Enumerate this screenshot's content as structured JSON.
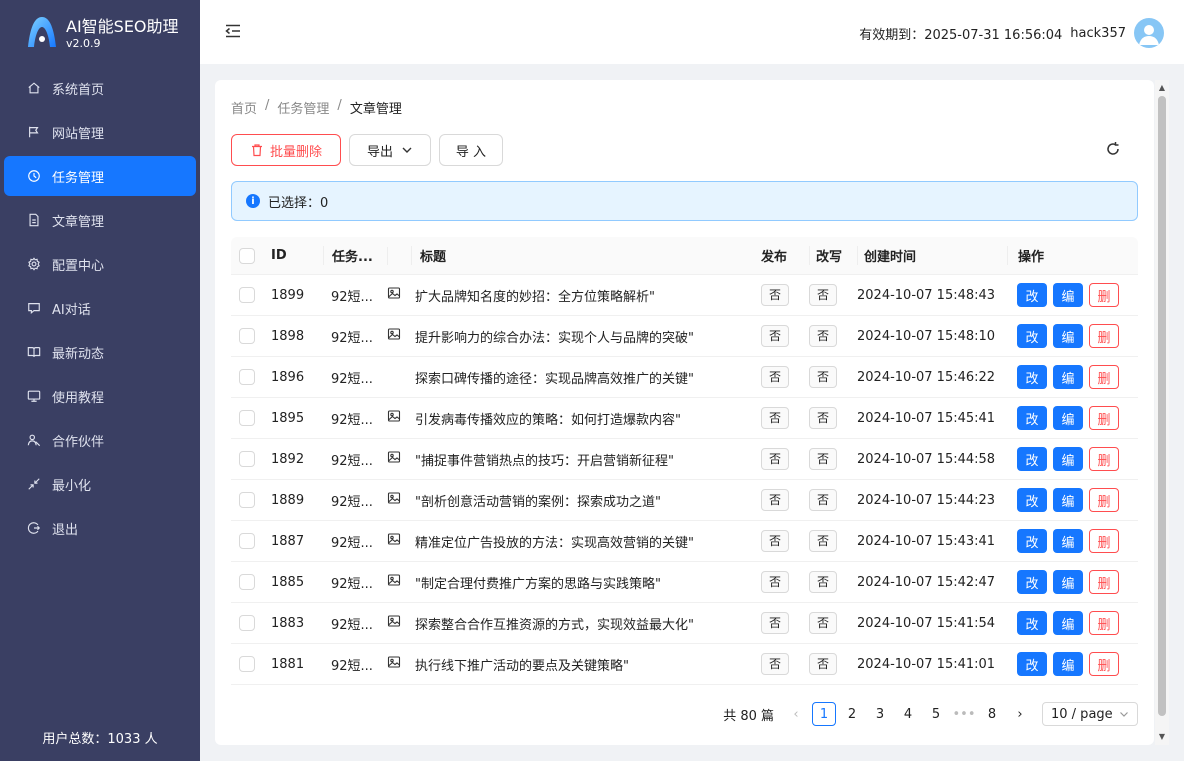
{
  "brand": {
    "title": "AI智能SEO助理",
    "version": "v2.0.9"
  },
  "sidebar": {
    "items": [
      {
        "label": "系统首页",
        "icon": "home-icon"
      },
      {
        "label": "网站管理",
        "icon": "flag-icon"
      },
      {
        "label": "任务管理",
        "icon": "clock-icon",
        "active": true
      },
      {
        "label": "文章管理",
        "icon": "file-icon"
      },
      {
        "label": "配置中心",
        "icon": "gear-icon"
      },
      {
        "label": "AI对话",
        "icon": "chat-icon"
      },
      {
        "label": "最新动态",
        "icon": "book-icon"
      },
      {
        "label": "使用教程",
        "icon": "monitor-icon"
      },
      {
        "label": "合作伙伴",
        "icon": "partner-icon"
      },
      {
        "label": "最小化",
        "icon": "shrink-icon"
      },
      {
        "label": "退出",
        "icon": "logout-icon"
      }
    ],
    "user_total": "用户总数：1033 人"
  },
  "header": {
    "expire_label": "有效期到：2025-07-31 16:56:04",
    "username": "hack357"
  },
  "breadcrumb": {
    "home": "首页",
    "sep": "/",
    "task": "任务管理",
    "current": "文章管理"
  },
  "toolbar": {
    "batch_delete": "批量删除",
    "export": "导出",
    "import": "导 入"
  },
  "alert": {
    "text": "已选择：0"
  },
  "table": {
    "headers": {
      "id": "ID",
      "task": "任务...",
      "title": "标题",
      "publish": "发布",
      "rewrite": "改写",
      "created": "创建时间",
      "ops": "操作"
    },
    "ops": {
      "modify": "改",
      "edit": "编",
      "delete": "删"
    },
    "rows": [
      {
        "id": "1899",
        "task": "92短...",
        "img": true,
        "title": "扩大品牌知名度的妙招：全方位策略解析\"",
        "publish": "否",
        "rewrite": "否",
        "created": "2024-10-07 15:48:43"
      },
      {
        "id": "1898",
        "task": "92短...",
        "img": true,
        "title": "提升影响力的综合办法：实现个人与品牌的突破\"",
        "publish": "否",
        "rewrite": "否",
        "created": "2024-10-07 15:48:10"
      },
      {
        "id": "1896",
        "task": "92短...",
        "img": false,
        "title": "探索口碑传播的途径：实现品牌高效推广的关键\"",
        "publish": "否",
        "rewrite": "否",
        "created": "2024-10-07 15:46:22"
      },
      {
        "id": "1895",
        "task": "92短...",
        "img": true,
        "title": "引发病毒传播效应的策略：如何打造爆款内容\"",
        "publish": "否",
        "rewrite": "否",
        "created": "2024-10-07 15:45:41"
      },
      {
        "id": "1892",
        "task": "92短...",
        "img": true,
        "title": "\"捕捉事件营销热点的技巧：开启营销新征程\"",
        "publish": "否",
        "rewrite": "否",
        "created": "2024-10-07 15:44:58"
      },
      {
        "id": "1889",
        "task": "92短...",
        "img": true,
        "title": "\"剖析创意活动营销的案例：探索成功之道\"",
        "publish": "否",
        "rewrite": "否",
        "created": "2024-10-07 15:44:23"
      },
      {
        "id": "1887",
        "task": "92短...",
        "img": true,
        "title": "精准定位广告投放的方法：实现高效营销的关键\"",
        "publish": "否",
        "rewrite": "否",
        "created": "2024-10-07 15:43:41"
      },
      {
        "id": "1885",
        "task": "92短...",
        "img": true,
        "title": "\"制定合理付费推广方案的思路与实践策略\"",
        "publish": "否",
        "rewrite": "否",
        "created": "2024-10-07 15:42:47"
      },
      {
        "id": "1883",
        "task": "92短...",
        "img": true,
        "title": "探索整合合作互推资源的方式，实现效益最大化\"",
        "publish": "否",
        "rewrite": "否",
        "created": "2024-10-07 15:41:54"
      },
      {
        "id": "1881",
        "task": "92短...",
        "img": true,
        "title": "执行线下推广活动的要点及关键策略\"",
        "publish": "否",
        "rewrite": "否",
        "created": "2024-10-07 15:41:01"
      }
    ]
  },
  "pagination": {
    "total": "共 80 篇",
    "pages": [
      "1",
      "2",
      "3",
      "4",
      "5",
      "•••",
      "8"
    ],
    "current": "1",
    "page_size": "10 / page"
  },
  "colors": {
    "sidebar": "#3a3f63",
    "primary": "#1677ff",
    "danger": "#ff4d4f"
  }
}
